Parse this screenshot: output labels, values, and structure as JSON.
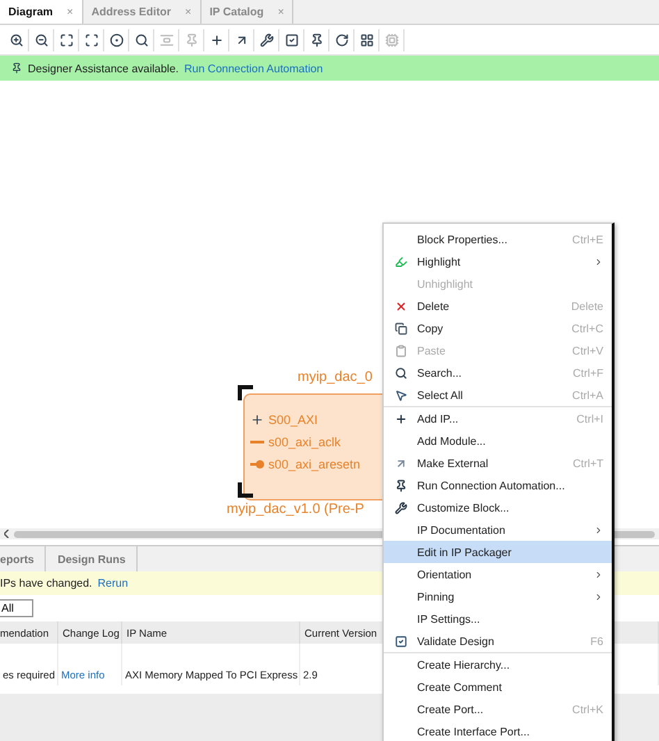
{
  "tabs": [
    {
      "label": "Diagram",
      "selected": true,
      "close": "×"
    },
    {
      "label": "Address Editor",
      "selected": false,
      "close": "×"
    },
    {
      "label": "IP Catalog",
      "selected": false,
      "close": "×"
    }
  ],
  "toolbar": [
    {
      "kind": "zoom-in",
      "disabled": false
    },
    {
      "kind": "zoom-out",
      "disabled": false
    },
    {
      "kind": "fit",
      "disabled": false
    },
    {
      "kind": "fit-selection",
      "disabled": false
    },
    {
      "kind": "auto-fit",
      "disabled": false
    },
    {
      "kind": "search",
      "disabled": false
    },
    {
      "kind": "align",
      "disabled": true
    },
    {
      "kind": "pin",
      "disabled": true
    },
    {
      "kind": "add",
      "disabled": false
    },
    {
      "kind": "external",
      "disabled": false
    },
    {
      "kind": "wrench",
      "disabled": false
    },
    {
      "kind": "validate",
      "disabled": false
    },
    {
      "kind": "automation",
      "disabled": false
    },
    {
      "kind": "refresh",
      "disabled": false
    },
    {
      "kind": "layout",
      "disabled": false
    },
    {
      "kind": "chip",
      "disabled": true
    }
  ],
  "banner": {
    "text": "Designer Assistance available.",
    "link": "Run Connection Automation"
  },
  "block": {
    "name": "myip_dac_0",
    "type": "myip_dac_v1.0 (Pre-P",
    "ports": [
      {
        "kind": "bus",
        "label": "S00_AXI"
      },
      {
        "kind": "clock",
        "label": "s00_axi_aclk"
      },
      {
        "kind": "reset",
        "label": "s00_axi_aresetn"
      }
    ]
  },
  "bottom": {
    "tabs": [
      {
        "label": "eports",
        "selected": false
      },
      {
        "label": "Design Runs",
        "selected": false
      }
    ],
    "notice": {
      "text": "IPs have changed.",
      "link": "Rerun"
    },
    "button": "All",
    "columns": [
      "mendation",
      "Change Log",
      "IP Name",
      "Current Version"
    ],
    "rows": [
      {
        "recommendation": "es required",
        "change_log": "More info",
        "ip_name": "AXI Memory Mapped To PCI Express",
        "version": "2.9"
      }
    ]
  },
  "menu": [
    {
      "label": "Block Properties...",
      "shortcut": "Ctrl+E",
      "kind": "none",
      "disabled": false,
      "selected": false,
      "submenu": false,
      "divider_before": false
    },
    {
      "label": "Highlight",
      "kind": "highlight",
      "disabled": false,
      "selected": false,
      "submenu": true,
      "divider_before": false
    },
    {
      "label": "Unhighlight",
      "kind": "none",
      "disabled": true,
      "selected": false,
      "submenu": false,
      "divider_before": false
    },
    {
      "label": "Delete",
      "shortcut": "Delete",
      "kind": "delete",
      "disabled": false,
      "selected": false,
      "submenu": false,
      "divider_before": false
    },
    {
      "label": "Copy",
      "shortcut": "Ctrl+C",
      "kind": "copy",
      "disabled": false,
      "selected": false,
      "submenu": false,
      "divider_before": false
    },
    {
      "label": "Paste",
      "shortcut": "Ctrl+V",
      "kind": "paste",
      "disabled": true,
      "selected": false,
      "submenu": false,
      "divider_before": false
    },
    {
      "label": "Search...",
      "shortcut": "Ctrl+F",
      "kind": "search",
      "disabled": false,
      "selected": false,
      "submenu": false,
      "divider_before": false
    },
    {
      "label": "Select All",
      "shortcut": "Ctrl+A",
      "kind": "select",
      "disabled": false,
      "selected": false,
      "submenu": false,
      "divider_before": false
    },
    {
      "label": "Add IP...",
      "shortcut": "Ctrl+I",
      "kind": "add",
      "disabled": false,
      "selected": false,
      "submenu": false,
      "divider_before": true
    },
    {
      "label": "Add Module...",
      "kind": "none",
      "disabled": false,
      "selected": false,
      "submenu": false,
      "divider_before": false
    },
    {
      "label": "Make External",
      "shortcut": "Ctrl+T",
      "kind": "external",
      "disabled": false,
      "selected": false,
      "submenu": false,
      "divider_before": false
    },
    {
      "label": "Run Connection Automation...",
      "kind": "automation",
      "disabled": false,
      "selected": false,
      "submenu": false,
      "divider_before": false
    },
    {
      "label": "Customize Block...",
      "kind": "wrench",
      "disabled": false,
      "selected": false,
      "submenu": false,
      "divider_before": false
    },
    {
      "label": "IP Documentation",
      "kind": "none",
      "disabled": false,
      "selected": false,
      "submenu": true,
      "divider_before": false
    },
    {
      "label": "Edit in IP Packager",
      "kind": "none",
      "disabled": false,
      "selected": true,
      "submenu": false,
      "divider_before": false
    },
    {
      "label": "Orientation",
      "kind": "none",
      "disabled": false,
      "selected": false,
      "submenu": true,
      "divider_before": false
    },
    {
      "label": "Pinning",
      "kind": "none",
      "disabled": false,
      "selected": false,
      "submenu": true,
      "divider_before": false
    },
    {
      "label": "IP Settings...",
      "kind": "none",
      "disabled": false,
      "selected": false,
      "submenu": false,
      "divider_before": false
    },
    {
      "label": "Validate Design",
      "shortcut": "F6",
      "kind": "validate",
      "disabled": false,
      "selected": false,
      "submenu": false,
      "divider_before": false
    },
    {
      "label": "Create Hierarchy...",
      "kind": "none",
      "disabled": false,
      "selected": false,
      "submenu": false,
      "divider_before": true
    },
    {
      "label": "Create Comment",
      "kind": "none",
      "disabled": false,
      "selected": false,
      "submenu": false,
      "divider_before": false
    },
    {
      "label": "Create Port...",
      "shortcut": "Ctrl+K",
      "kind": "none",
      "disabled": false,
      "selected": false,
      "submenu": false,
      "divider_before": false
    },
    {
      "label": "Create Interface Port...",
      "kind": "none",
      "disabled": false,
      "selected": false,
      "submenu": false,
      "divider_before": false
    }
  ]
}
